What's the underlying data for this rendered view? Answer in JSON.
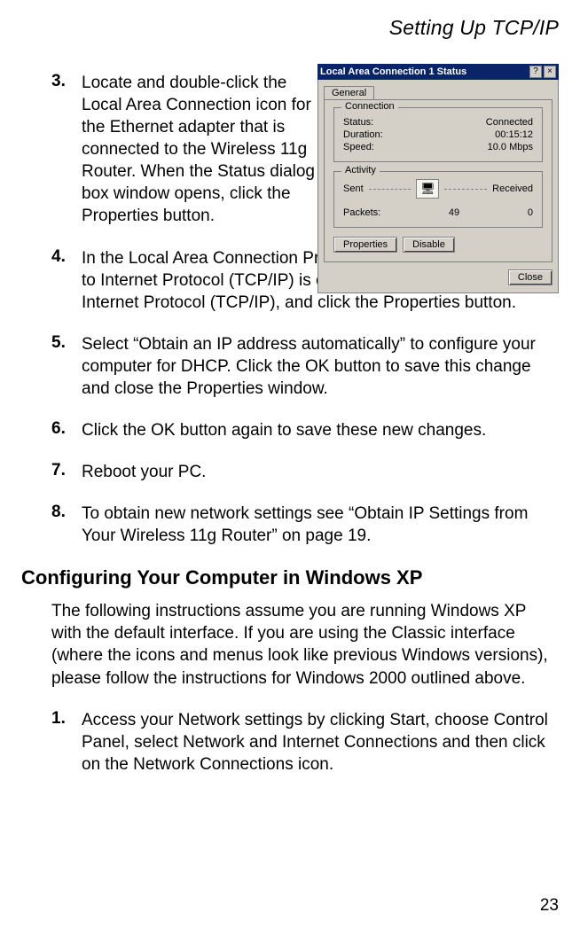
{
  "running_head": "Setting Up TCP/IP",
  "page_number": "23",
  "steps": {
    "s3": {
      "num": "3.",
      "text": "Locate and double-click the Local Area Connection icon for the Ethernet adapter that is connected to the Wireless 11g Router. When the Status dialog box window opens, click the Properties button."
    },
    "s4": {
      "num": "4.",
      "text": "In the Local Area Connection Properties box, verify the box next to Internet Protocol (TCP/IP) is checked. Then highlight the Internet Protocol (TCP/IP), and click the Properties button."
    },
    "s5": {
      "num": "5.",
      "text": "Select “Obtain an IP address automatically” to configure your computer for DHCP. Click the OK button to save this change and close the Properties window."
    },
    "s6": {
      "num": "6.",
      "text": "Click the OK button again to save these new changes."
    },
    "s7": {
      "num": "7.",
      "text": "Reboot your PC."
    },
    "s8": {
      "num": "8.",
      "text": "To obtain new network settings see “Obtain IP Settings from Your Wireless 11g Router” on page 19."
    }
  },
  "section_heading": "Configuring Your Computer in Windows XP",
  "section_intro": "The following instructions assume you are running Windows XP with the default interface. If you are using the Classic interface (where the icons and menus look like previous Windows versions), please follow the instructions for Windows 2000 outlined above.",
  "xp_steps": {
    "s1": {
      "num": "1.",
      "text": "Access your Network settings by clicking Start, choose Control Panel, select Network and Internet Connections and then click on the Network Connections icon."
    }
  },
  "dialog": {
    "title": "Local Area Connection 1 Status",
    "help_glyph": "?",
    "close_glyph": "×",
    "tab_general": "General",
    "connection": {
      "legend": "Connection",
      "status_label": "Status:",
      "status_value": "Connected",
      "duration_label": "Duration:",
      "duration_value": "00:15:12",
      "speed_label": "Speed:",
      "speed_value": "10.0 Mbps"
    },
    "activity": {
      "legend": "Activity",
      "sent_label": "Sent",
      "received_label": "Received",
      "packets_label": "Packets:",
      "packets_sent": "49",
      "packets_received": "0",
      "icon_glyph": "🖥"
    },
    "properties_btn": "Properties",
    "disable_btn": "Disable",
    "close_btn": "Close"
  }
}
